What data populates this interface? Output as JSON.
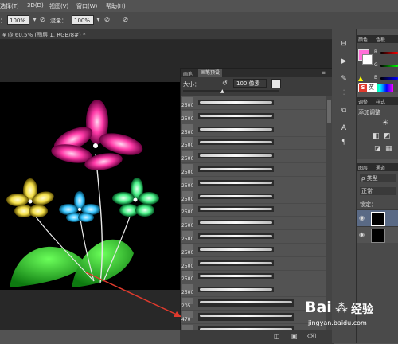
{
  "menu": [
    "选择(T)",
    "3D(D)",
    "视图(V)",
    "窗口(W)",
    "帮助(H)"
  ],
  "options": {
    "opacity_label_suffix": "：",
    "opacity_value": "100%",
    "flow_label": "流量：",
    "flow_value": "100%"
  },
  "doc_tab": "¥ @ 60.5% (图层 1, RGB/8#) *",
  "brush_panel": {
    "tabs": [
      "画笔",
      "画笔预设"
    ],
    "size_label": "大小：",
    "size_value": "100 像素",
    "numbers": [
      "2500",
      "2500",
      "2500",
      "2500",
      "2500",
      "2500",
      "2500",
      "2500",
      "2500",
      "2500",
      "2500",
      "2500",
      "2500",
      "2500",
      "2500",
      "205",
      "470",
      "1024"
    ]
  },
  "right": {
    "color_tabs": [
      "颜色",
      "色板"
    ],
    "channels": [
      "R",
      "G",
      "B"
    ],
    "ime": {
      "badge": "S",
      "text": "英"
    },
    "adjust_tabs": [
      "调整",
      "样式"
    ],
    "adjust_title": "添加调整",
    "layer_tabs": [
      "图层",
      "通道"
    ],
    "kind": "ρ 类型",
    "mode": "正常",
    "lock_label": "锁定："
  },
  "watermark": {
    "brand": "Bai",
    "suffix": "经验",
    "url": "jingyan.baidu.com"
  },
  "colors": {
    "accent_red": "#e03a2d",
    "flower_pink": "#ff3aa8",
    "flower_yellow": "#f4e04a",
    "flower_blue": "#3bc6ff",
    "flower_green": "#4cf28a"
  }
}
